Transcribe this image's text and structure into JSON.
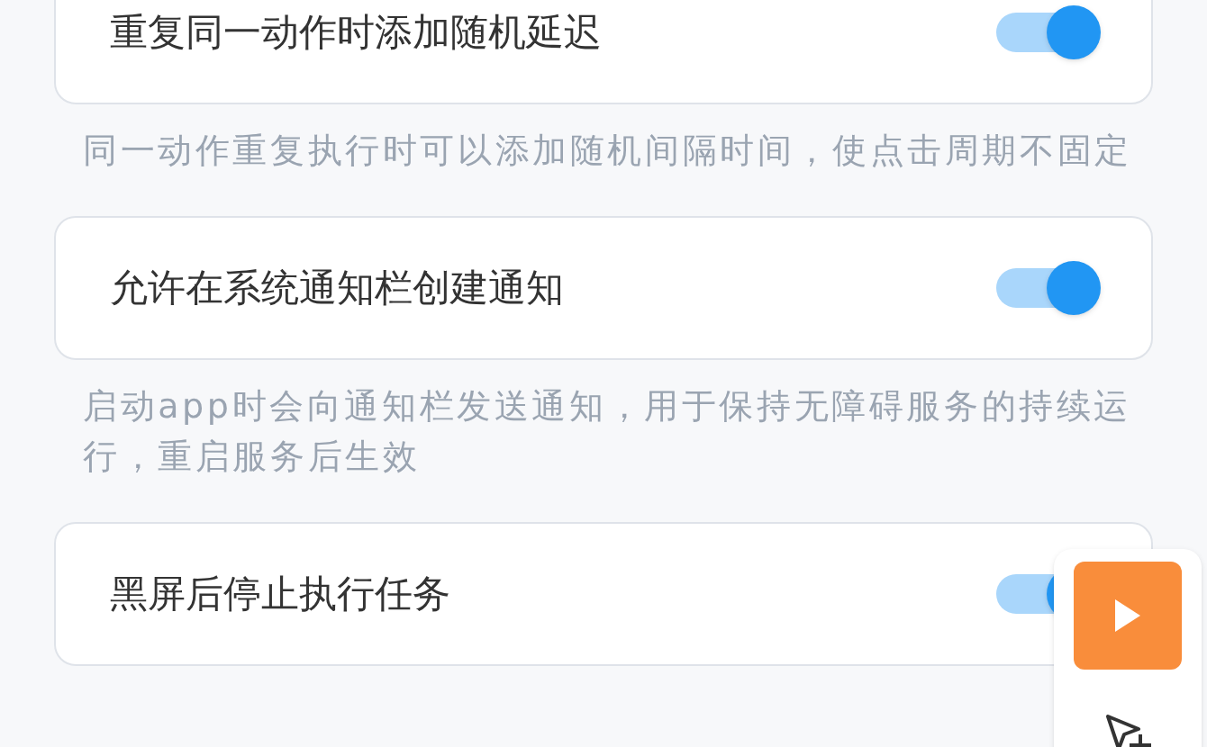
{
  "settings": [
    {
      "title": "重复同一动作时添加随机延迟",
      "on": true,
      "description": "同一动作重复执行时可以添加随机间隔时间，使点击周期不固定"
    },
    {
      "title": "允许在系统通知栏创建通知",
      "on": true,
      "description": "启动app时会向通知栏发送通知，用于保持无障碍服务的持续运行，重启服务后生效"
    },
    {
      "title": "黑屏后停止执行任务",
      "on": true
    }
  ]
}
